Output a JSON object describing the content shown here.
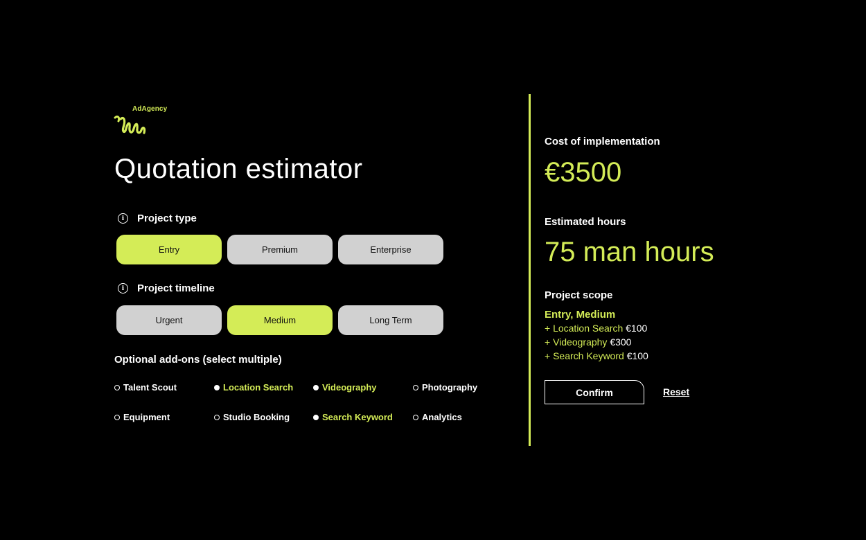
{
  "brand": {
    "name": "AdAgency",
    "accent_color": "#d4ec57",
    "background": "#000000"
  },
  "page_title": "Quotation estimator",
  "project_type": {
    "label": "Project type",
    "options": [
      "Entry",
      "Premium",
      "Enterprise"
    ],
    "selected": "Entry"
  },
  "project_timeline": {
    "label": "Project timeline",
    "options": [
      "Urgent",
      "Medium",
      "Long Term"
    ],
    "selected": "Medium"
  },
  "addons": {
    "title": "Optional add-ons (select multiple)",
    "items": [
      {
        "label": "Talent Scout",
        "selected": false
      },
      {
        "label": "Location Search",
        "selected": true
      },
      {
        "label": "Videography",
        "selected": true
      },
      {
        "label": "Photography",
        "selected": false
      },
      {
        "label": "Equipment",
        "selected": false
      },
      {
        "label": "Studio Booking",
        "selected": false
      },
      {
        "label": "Search Keyword",
        "selected": true
      },
      {
        "label": "Analytics",
        "selected": false
      }
    ]
  },
  "summary": {
    "cost_label": "Cost of implementation",
    "cost_value": "€3500",
    "hours_label": "Estimated hours",
    "hours_value": "75 man hours",
    "scope_label": "Project scope",
    "scope_main": "Entry, Medium",
    "scope_items": [
      {
        "name": "+ Location Search",
        "price": "€100"
      },
      {
        "name": "+ Videography",
        "price": "€300"
      },
      {
        "name": "+ Search Keyword",
        "price": "€100"
      }
    ],
    "confirm_label": "Confirm",
    "reset_label": "Reset"
  }
}
